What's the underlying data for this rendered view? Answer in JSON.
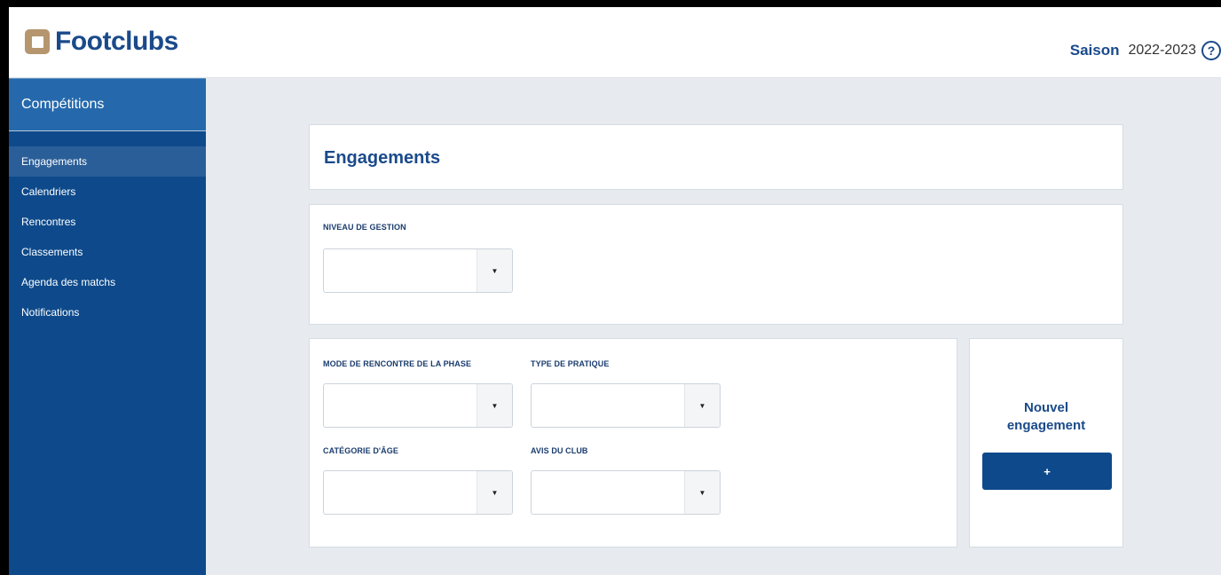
{
  "app": {
    "name": "Footclubs"
  },
  "season": {
    "label": "Saison",
    "value": "2022-2023",
    "help_glyph": "?"
  },
  "sidebar": {
    "title": "Compétitions",
    "items": [
      {
        "label": "Engagements",
        "active": true
      },
      {
        "label": "Calendriers"
      },
      {
        "label": "Rencontres"
      },
      {
        "label": "Classements"
      },
      {
        "label": "Agenda des matchs"
      },
      {
        "label": "Notifications"
      }
    ]
  },
  "page": {
    "title": "Engagements"
  },
  "filters": {
    "niveau_gestion": {
      "label": "NIVEAU DE GESTION",
      "value": ""
    },
    "mode_rencontre": {
      "label": "MODE DE RENCONTRE DE LA PHASE",
      "value": ""
    },
    "type_pratique": {
      "label": "TYPE DE PRATIQUE",
      "value": ""
    },
    "categorie_age": {
      "label": "CATÉGORIE D'ÂGE",
      "value": ""
    },
    "avis_club": {
      "label": "AVIS DU CLUB",
      "value": ""
    },
    "arrow_glyph": "▼"
  },
  "new_engagement": {
    "title_line1": "Nouvel",
    "title_line2": "engagement",
    "button_label": "+"
  },
  "colors": {
    "brand_blue": "#0e4a8b",
    "logo_gold": "#b6966e",
    "background": "#e7ebf0"
  }
}
